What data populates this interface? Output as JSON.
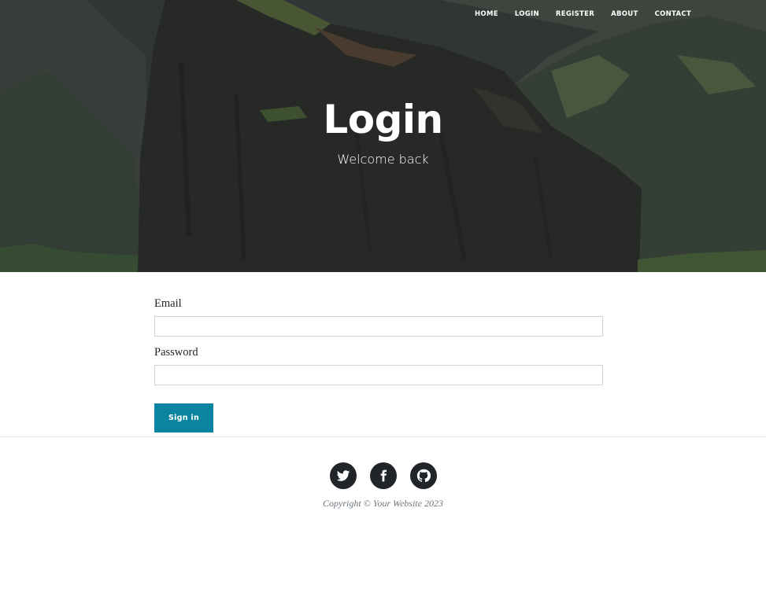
{
  "nav": {
    "items": [
      {
        "label": "HOME"
      },
      {
        "label": "LOGIN"
      },
      {
        "label": "REGISTER"
      },
      {
        "label": "ABOUT"
      },
      {
        "label": "CONTACT"
      }
    ]
  },
  "hero": {
    "title": "Login",
    "subtitle": "Welcome back"
  },
  "form": {
    "email_label": "Email",
    "email_value": "",
    "password_label": "Password",
    "password_value": "",
    "submit_label": "Sign in"
  },
  "footer": {
    "social": [
      "twitter-icon",
      "facebook-icon",
      "github-icon"
    ],
    "copyright": "Copyright © Your Website 2023"
  },
  "colors": {
    "accent": "#0a85a1",
    "social_bg": "#212529",
    "divider": "#dee2e6"
  }
}
